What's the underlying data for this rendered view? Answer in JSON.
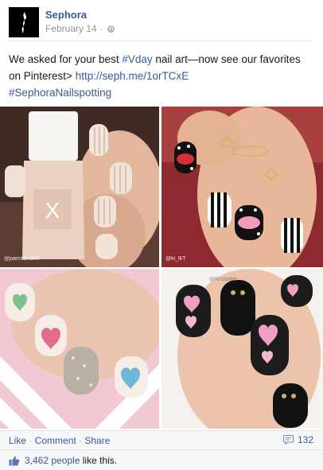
{
  "post": {
    "page_name": "Sephora",
    "date": "February 14",
    "message_lead": "We asked for your best ",
    "hashtag_vday": "#Vday",
    "message_mid": " nail art—now see our favorites on Pinterest> ",
    "link_url": "http://seph.me/1orTCxE",
    "hashtag_spotting": "#SephoraNailspotting"
  },
  "photos": {
    "credit_1": "@pamsandkin",
    "credit_2": "@ki_lkT",
    "credit_3": "@Kristalilie"
  },
  "actions": {
    "like": "Like",
    "sep": " · ",
    "comment": "Comment",
    "share": "Share",
    "comment_count": "132"
  },
  "likes": {
    "count": "3,462 people",
    "suffix": " like this."
  },
  "colors": {
    "link": "#3b5998",
    "muted": "#9197a3",
    "footer_bg": "#f6f7f8"
  },
  "icons": {
    "avatar": "sephora-logo",
    "privacy": "globe-icon",
    "comments": "comment-bubble-icon",
    "likes": "thumbs-up-icon"
  }
}
